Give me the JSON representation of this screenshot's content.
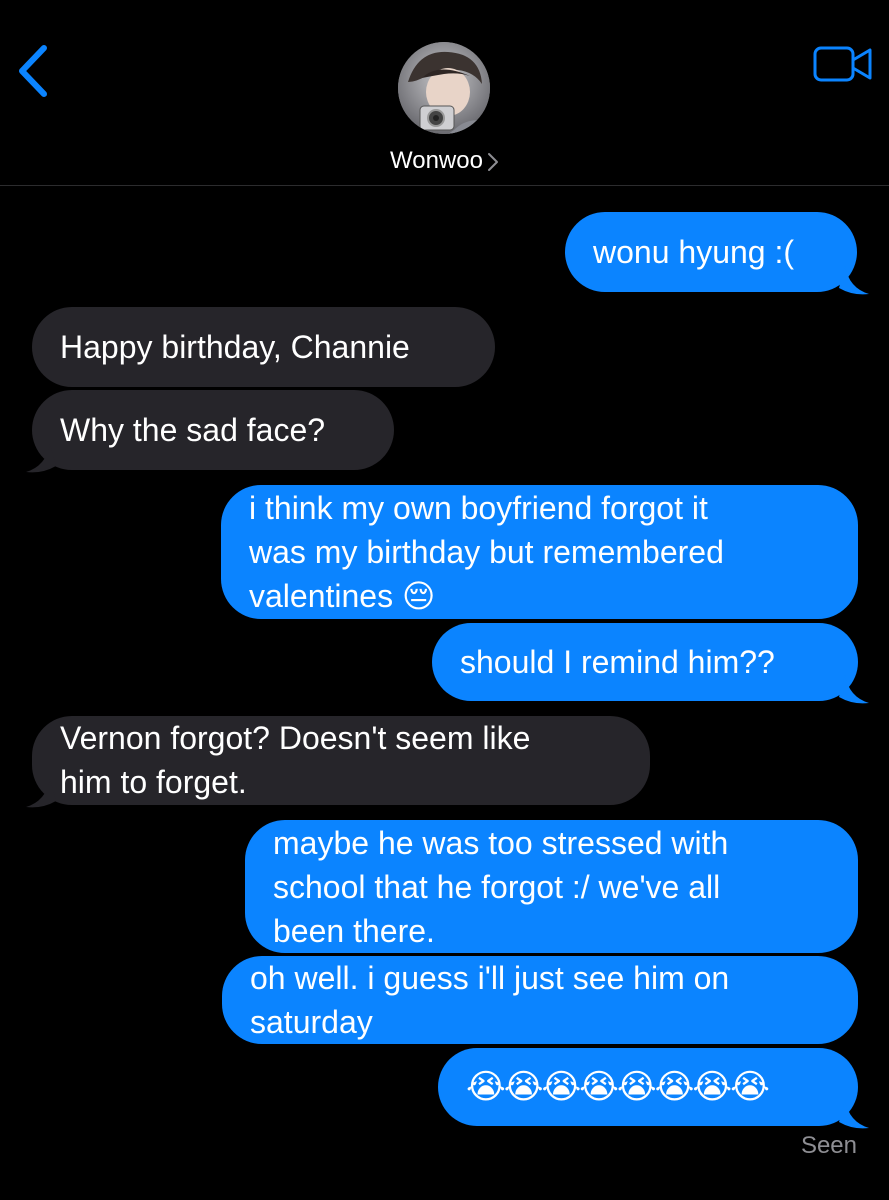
{
  "header": {
    "contact_name": "Wonwoo",
    "back_icon": "chevron-left-icon",
    "video_icon": "video-camera-icon",
    "accent_color": "#0b84ff"
  },
  "messages": [
    {
      "id": "m1",
      "direction": "sent",
      "text": "wonu hyung :("
    },
    {
      "id": "m2",
      "direction": "received",
      "text": "Happy birthday, Channie"
    },
    {
      "id": "m3",
      "direction": "received",
      "text": "Why the sad face?"
    },
    {
      "id": "m4",
      "direction": "sent",
      "text": "i think my own boyfriend forgot it\nwas my birthday but remembered\nvalentines 😔"
    },
    {
      "id": "m5",
      "direction": "sent",
      "text": "should I remind him??"
    },
    {
      "id": "m6",
      "direction": "received",
      "text": "Vernon forgot? Doesn't seem like\nhim to forget."
    },
    {
      "id": "m7",
      "direction": "sent",
      "text": "maybe he was too stressed with\nschool that he forgot :/ we've all\nbeen there."
    },
    {
      "id": "m8",
      "direction": "sent",
      "text": "oh well. i guess i'll just see him on\nsaturday"
    },
    {
      "id": "m9",
      "direction": "sent",
      "text": "😭😭😭😭😭😭😭😭"
    }
  ],
  "status": {
    "seen_label": "Seen"
  },
  "colors": {
    "sent_bubble": "#0b84ff",
    "received_bubble": "#26252a",
    "background": "#000000",
    "meta_text": "#8e8e93"
  }
}
